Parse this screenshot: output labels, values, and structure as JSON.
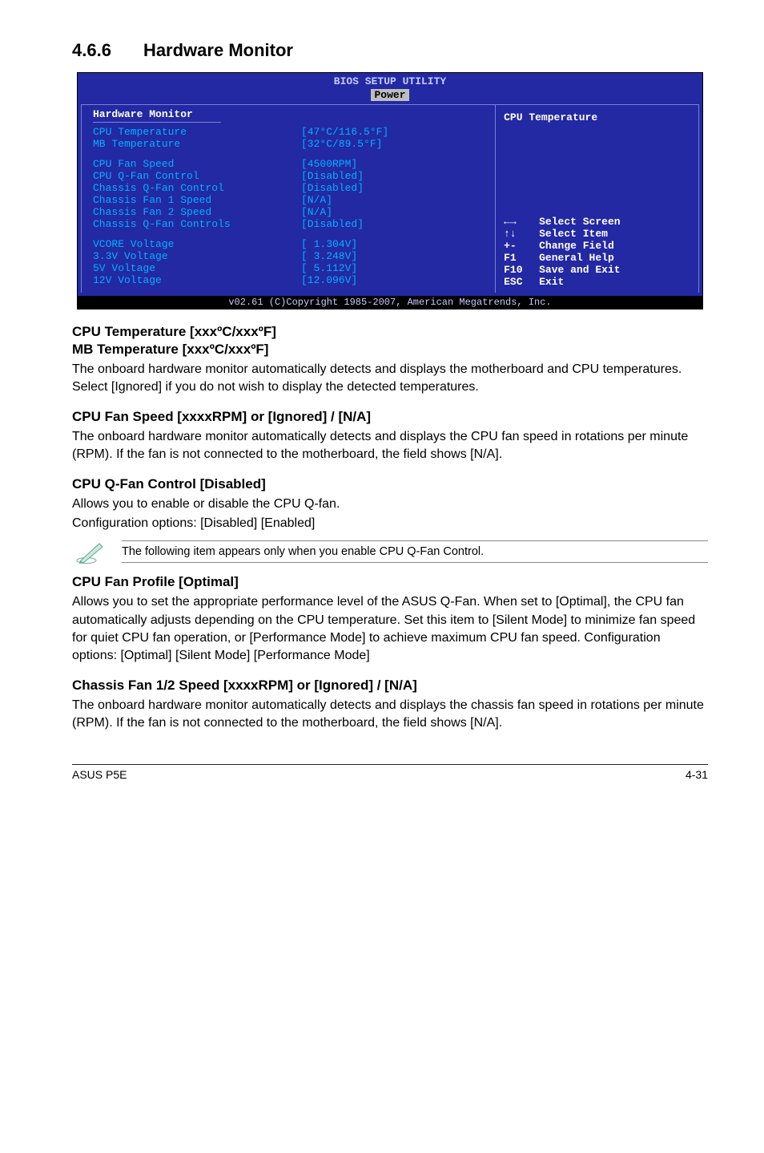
{
  "section": {
    "number": "4.6.6",
    "title": "Hardware Monitor"
  },
  "bios": {
    "app_title": "BIOS SETUP UTILITY",
    "tab": "Power",
    "panel_title": "Hardware Monitor",
    "rows": [
      {
        "label": "CPU Temperature",
        "value": "[47°C/116.5°F]"
      },
      {
        "label": "MB Temperature",
        "value": "[32°C/89.5°F]"
      }
    ],
    "rows2": [
      {
        "label": "CPU Fan Speed",
        "value": "[4500RPM]"
      },
      {
        "label": "CPU Q-Fan Control",
        "value": "[Disabled]"
      },
      {
        "label": "Chassis Q-Fan Control",
        "value": "[Disabled]"
      },
      {
        "label": "Chassis Fan 1 Speed",
        "value": "[N/A]"
      },
      {
        "label": "Chassis Fan 2 Speed",
        "value": "[N/A]"
      },
      {
        "label": "Chassis Q-Fan Controls",
        "value": "[Disabled]"
      }
    ],
    "rows3": [
      {
        "label": "VCORE Voltage",
        "value": "[ 1.304V]"
      },
      {
        "label": "3.3V  Voltage",
        "value": "[ 3.248V]"
      },
      {
        "label": "5V    Voltage",
        "value": "[ 5.112V]"
      },
      {
        "label": "12V   Voltage",
        "value": "[12.096V]"
      }
    ],
    "right_title": "CPU Temperature",
    "hints": [
      {
        "key": "←→",
        "txt": "Select Screen"
      },
      {
        "key": "↑↓",
        "txt": "Select Item"
      },
      {
        "key": "+-",
        "txt": "Change Field"
      },
      {
        "key": "F1",
        "txt": "General Help"
      },
      {
        "key": "F10",
        "txt": "Save and Exit"
      },
      {
        "key": "ESC",
        "txt": "Exit"
      }
    ],
    "footer": "v02.61 (C)Copyright 1985-2007, American Megatrends, Inc."
  },
  "blocks": {
    "cpu_mb_temp_h1": "CPU Temperature [xxxºC/xxxºF]",
    "cpu_mb_temp_h2": "MB Temperature [xxxºC/xxxºF]",
    "cpu_mb_temp_body": "The onboard hardware monitor automatically detects and displays the motherboard and CPU temperatures. Select [Ignored] if you do not wish to display the detected temperatures.",
    "cpu_fan_speed_h": "CPU Fan Speed [xxxxRPM] or [Ignored] / [N/A]",
    "cpu_fan_speed_body": "The onboard hardware monitor automatically detects and displays the CPU fan speed in rotations per minute (RPM). If the fan is not connected to the motherboard, the field shows [N/A].",
    "cpu_qfan_h": "CPU Q-Fan Control [Disabled]",
    "cpu_qfan_l1": "Allows you to enable or disable the CPU Q-fan.",
    "cpu_qfan_l2": "Configuration options: [Disabled] [Enabled]",
    "note_text": "The following item appears only when you enable CPU Q-Fan Control.",
    "cpu_fan_profile_h": "CPU Fan Profile [Optimal]",
    "cpu_fan_profile_body": "Allows you to set the appropriate performance level of the ASUS Q-Fan. When set to [Optimal], the CPU fan automatically adjusts depending on the CPU temperature. Set this item to [Silent Mode] to minimize fan speed for quiet CPU fan operation, or [Performance Mode] to achieve maximum CPU fan speed. Configuration options: [Optimal] [Silent Mode] [Performance Mode]",
    "chassis_fan_h": "Chassis Fan 1/2 Speed [xxxxRPM] or [Ignored] / [N/A]",
    "chassis_fan_body": "The onboard hardware monitor automatically detects and displays the chassis fan speed in rotations per minute (RPM). If the fan is not connected to the motherboard, the field shows [N/A]."
  },
  "footer": {
    "left": "ASUS P5E",
    "right": "4-31"
  }
}
